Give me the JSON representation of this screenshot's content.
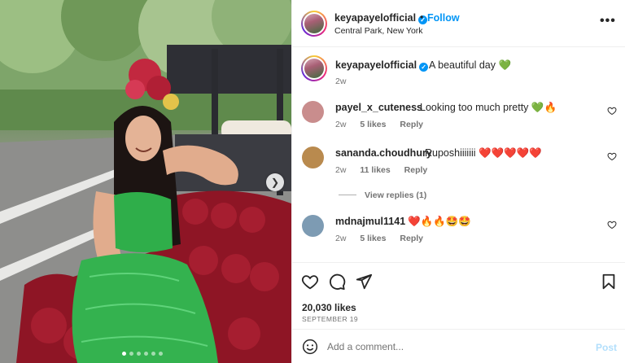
{
  "post": {
    "username": "keyapayelofficial",
    "separator": "•",
    "follow_label": "Follow",
    "location": "Central Park, New York",
    "more_icon": "more-icon",
    "carousel_dots": 6,
    "active_dot": 0
  },
  "caption": {
    "username": "keyapayelofficial",
    "text": "A beautiful day 💚",
    "time": "2w"
  },
  "comments": [
    {
      "username": "payel_x_cuteness",
      "text": "Looking too much pretty 💚🔥",
      "time": "2w",
      "likes": "5 likes",
      "reply": "Reply",
      "avatar_color": "#c98d8d"
    },
    {
      "username": "sananda.choudhury",
      "text": "Ruposhiiiiiii ❤️❤️❤️❤️❤️",
      "time": "2w",
      "likes": "11 likes",
      "reply": "Reply",
      "avatar_color": "#b98a4e"
    },
    {
      "username": "mdnajmul1141",
      "text": "❤️🔥🔥🤩🤩",
      "time": "2w",
      "likes": "5 likes",
      "reply": "Reply",
      "avatar_color": "#7d9bb3"
    }
  ],
  "view_replies": "View replies (1)",
  "actions": {
    "likes": "20,030 likes",
    "date": "SEPTEMBER 19"
  },
  "add_comment": {
    "placeholder": "Add a comment...",
    "post_label": "Post"
  },
  "colors": {
    "accent": "#0095f6",
    "muted": "#737373",
    "post_disabled": "#b2dffc",
    "heart_green": "#4caf50"
  }
}
